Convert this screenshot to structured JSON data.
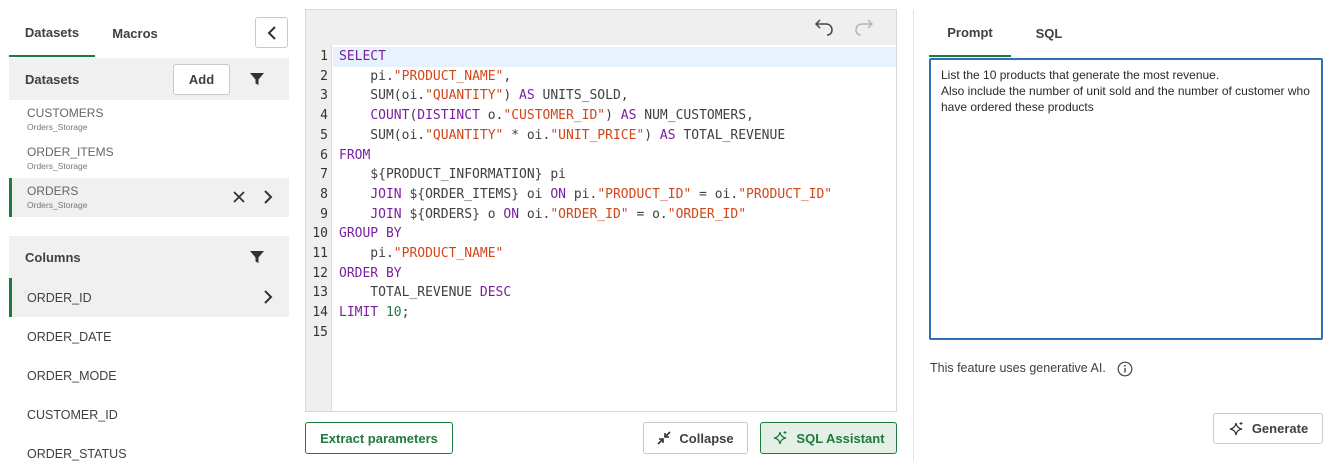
{
  "left_panel": {
    "tabs": [
      {
        "label": "Datasets",
        "active": true
      },
      {
        "label": "Macros",
        "active": false
      }
    ],
    "collapse_icon": "chevron-left-icon",
    "datasets_section": {
      "title": "Datasets",
      "add_label": "Add",
      "filter_icon": "filter-icon",
      "items": [
        {
          "name": "CUSTOMERS",
          "source": "Orders_Storage",
          "selected": false
        },
        {
          "name": "ORDER_ITEMS",
          "source": "Orders_Storage",
          "selected": false
        },
        {
          "name": "ORDERS",
          "source": "Orders_Storage",
          "selected": true
        }
      ]
    },
    "columns_section": {
      "title": "Columns",
      "filter_icon": "filter-icon",
      "items": [
        {
          "name": "ORDER_ID",
          "selected": true
        },
        {
          "name": "ORDER_DATE",
          "selected": false
        },
        {
          "name": "ORDER_MODE",
          "selected": false
        },
        {
          "name": "CUSTOMER_ID",
          "selected": false
        },
        {
          "name": "ORDER_STATUS",
          "selected": false
        }
      ]
    }
  },
  "editor": {
    "undo_icon": "undo-icon",
    "redo_icon": "redo-icon",
    "active_line": 1,
    "lines": [
      [
        {
          "t": "kw",
          "v": "SELECT"
        }
      ],
      [
        {
          "t": "plain",
          "v": "    pi."
        },
        {
          "t": "str",
          "v": "\"PRODUCT_NAME\""
        },
        {
          "t": "plain",
          "v": ","
        }
      ],
      [
        {
          "t": "plain",
          "v": "    SUM(oi."
        },
        {
          "t": "str",
          "v": "\"QUANTITY\""
        },
        {
          "t": "plain",
          "v": ") "
        },
        {
          "t": "kw",
          "v": "AS"
        },
        {
          "t": "plain",
          "v": " UNITS_SOLD,"
        }
      ],
      [
        {
          "t": "plain",
          "v": "    "
        },
        {
          "t": "kw",
          "v": "COUNT"
        },
        {
          "t": "plain",
          "v": "("
        },
        {
          "t": "kw",
          "v": "DISTINCT"
        },
        {
          "t": "plain",
          "v": " o."
        },
        {
          "t": "str",
          "v": "\"CUSTOMER_ID\""
        },
        {
          "t": "plain",
          "v": ") "
        },
        {
          "t": "kw",
          "v": "AS"
        },
        {
          "t": "plain",
          "v": " NUM_CUSTOMERS,"
        }
      ],
      [
        {
          "t": "plain",
          "v": "    SUM(oi."
        },
        {
          "t": "str",
          "v": "\"QUANTITY\""
        },
        {
          "t": "plain",
          "v": " * oi."
        },
        {
          "t": "str",
          "v": "\"UNIT_PRICE\""
        },
        {
          "t": "plain",
          "v": ") "
        },
        {
          "t": "kw",
          "v": "AS"
        },
        {
          "t": "plain",
          "v": " TOTAL_REVENUE"
        }
      ],
      [
        {
          "t": "kw",
          "v": "FROM"
        }
      ],
      [
        {
          "t": "plain",
          "v": "    ${PRODUCT_INFORMATION} pi"
        }
      ],
      [
        {
          "t": "plain",
          "v": "    "
        },
        {
          "t": "kw",
          "v": "JOIN"
        },
        {
          "t": "plain",
          "v": " ${ORDER_ITEMS} oi "
        },
        {
          "t": "kw",
          "v": "ON"
        },
        {
          "t": "plain",
          "v": " pi."
        },
        {
          "t": "str",
          "v": "\"PRODUCT_ID\""
        },
        {
          "t": "plain",
          "v": " = oi."
        },
        {
          "t": "str",
          "v": "\"PRODUCT_ID\""
        }
      ],
      [
        {
          "t": "plain",
          "v": "    "
        },
        {
          "t": "kw",
          "v": "JOIN"
        },
        {
          "t": "plain",
          "v": " ${ORDERS} o "
        },
        {
          "t": "kw",
          "v": "ON"
        },
        {
          "t": "plain",
          "v": " oi."
        },
        {
          "t": "str",
          "v": "\"ORDER_ID\""
        },
        {
          "t": "plain",
          "v": " = o."
        },
        {
          "t": "str",
          "v": "\"ORDER_ID\""
        }
      ],
      [
        {
          "t": "kw",
          "v": "GROUP BY"
        }
      ],
      [
        {
          "t": "plain",
          "v": "    pi."
        },
        {
          "t": "str",
          "v": "\"PRODUCT_NAME\""
        }
      ],
      [
        {
          "t": "kw",
          "v": "ORDER BY"
        }
      ],
      [
        {
          "t": "plain",
          "v": "    TOTAL_REVENUE "
        },
        {
          "t": "kw",
          "v": "DESC"
        }
      ],
      [
        {
          "t": "kw",
          "v": "LIMIT"
        },
        {
          "t": "plain",
          "v": " "
        },
        {
          "t": "num",
          "v": "10"
        },
        {
          "t": "plain",
          "v": ";"
        }
      ],
      []
    ]
  },
  "buttons": {
    "extract_label": "Extract parameters",
    "collapse_label": "Collapse",
    "sql_assistant_label": "SQL Assistant",
    "generate_label": "Generate"
  },
  "right_panel": {
    "tabs": [
      {
        "label": "Prompt",
        "active": true
      },
      {
        "label": "SQL",
        "active": false
      }
    ],
    "prompt_text": "List the 10 products that generate the most revenue.\nAlso include the number of unit sold and the number of customer who have ordered these products",
    "ai_note": "This feature uses generative AI.",
    "info_icon": "info-icon"
  },
  "colors": {
    "accent_green": "#1f7a3d",
    "focus_blue": "#2f6fb5",
    "keyword": "#7a1fa2",
    "string": "#d2461a",
    "number": "#1f7a3d"
  }
}
